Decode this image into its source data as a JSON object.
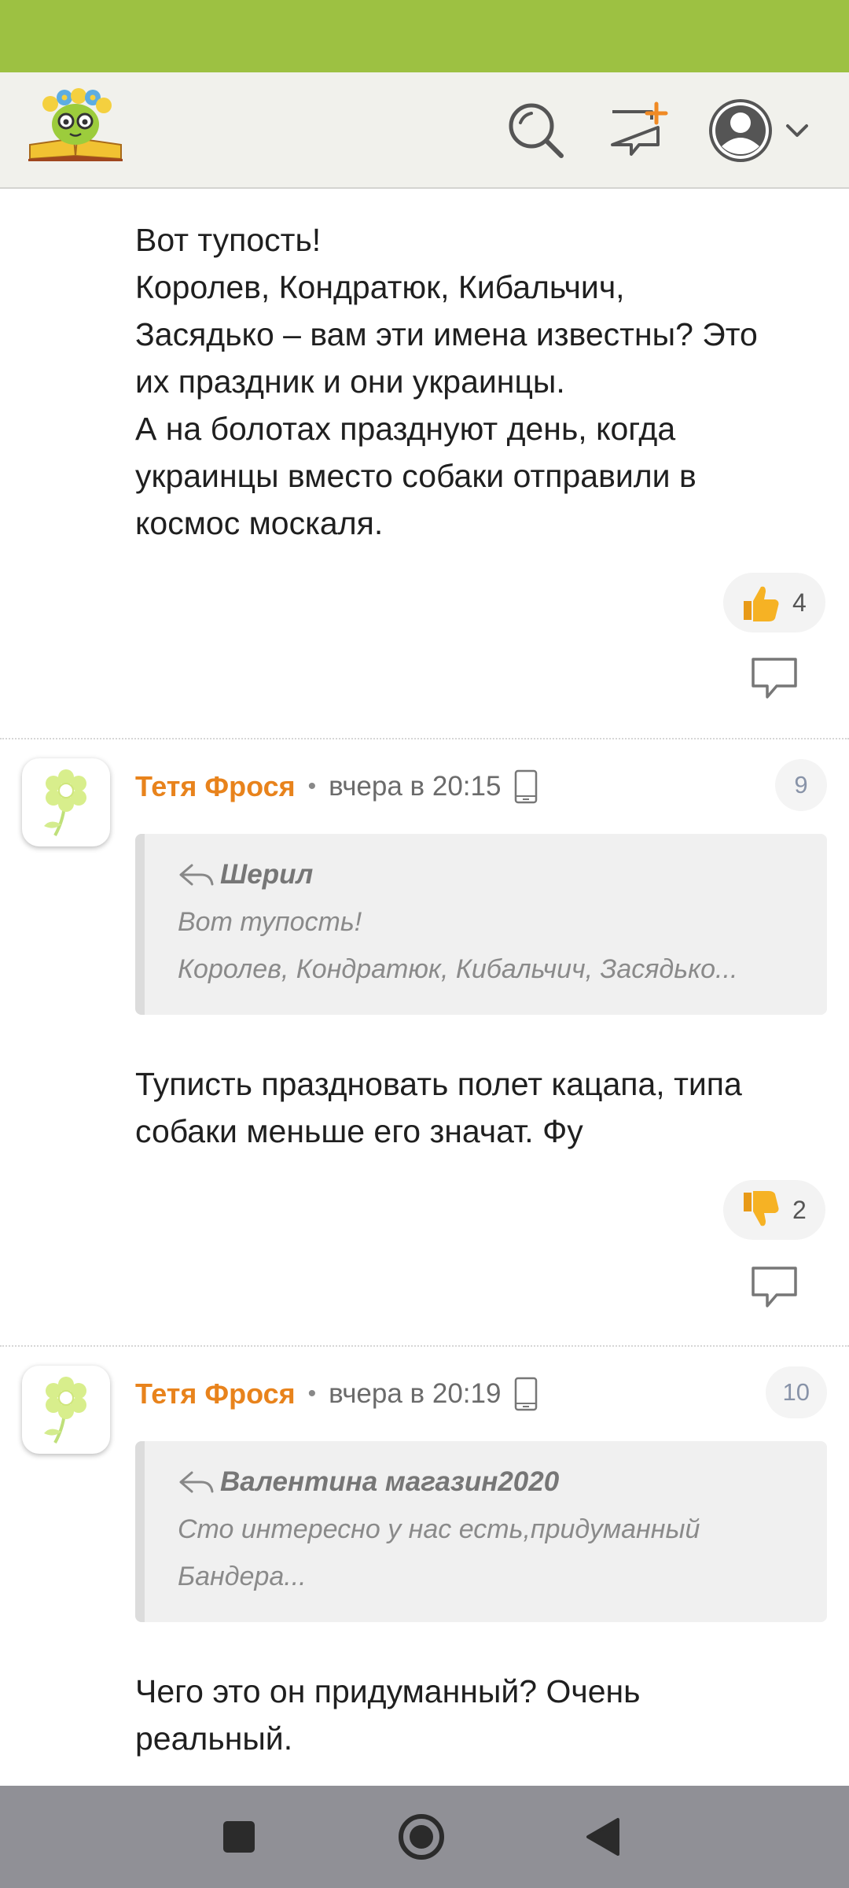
{
  "colors": {
    "accent_green": "#9dc142",
    "author_orange": "#e8831c",
    "header_bg": "#f1f1ec"
  },
  "header": {
    "logo_icon": "kid-with-flower-wreath-reading-book-logo",
    "search_icon": "search-icon",
    "new_topic_icon": "chat-bubble-plus-icon",
    "profile_icon": "user-avatar-icon",
    "profile_menu_icon": "chevron-down-icon"
  },
  "top_post": {
    "lines": [
      "Вот тупость!",
      "Королев, Кондратюк, Кибальчич,",
      "Засядько – вам эти имена известны? Это",
      "их праздник и они украинцы.",
      "А на болотах празднуют день, когда",
      "украинцы вместо собаки отправили в",
      "космос москаля."
    ],
    "reaction": {
      "icon": "thumbs-up-icon",
      "count": "4"
    }
  },
  "comments": [
    {
      "author": "Тетя Фрося",
      "separator": "•",
      "time": "вчера в 20:15",
      "device_icon": "mobile-phone-icon",
      "number": "9",
      "avatar_icon": "flower-avatar-icon",
      "quote": {
        "author": "Шерил",
        "lines": [
          "Вот тупость!",
          "Королев, Кондратюк, Кибальчич, Засядько..."
        ]
      },
      "lines": [
        "Туписть праздновать полет кацапа, типа",
        "собаки меньше его значат. Фу"
      ],
      "reaction": {
        "icon": "thumbs-down-icon",
        "count": "2"
      }
    },
    {
      "author": "Тетя Фрося",
      "separator": "•",
      "time": "вчера в 20:19",
      "device_icon": "mobile-phone-icon",
      "number": "10",
      "avatar_icon": "flower-avatar-icon",
      "quote": {
        "author": "Валентина магазин2020",
        "lines": [
          "Сто интересно у нас есть,придуманный",
          "Бандера..."
        ]
      },
      "lines": [
        "Чего это он придуманный? Очень",
        "реальный."
      ]
    }
  ],
  "nav_bar": {
    "recent_icon": "square-icon",
    "home_icon": "circle-icon",
    "back_icon": "triangle-back-icon"
  }
}
